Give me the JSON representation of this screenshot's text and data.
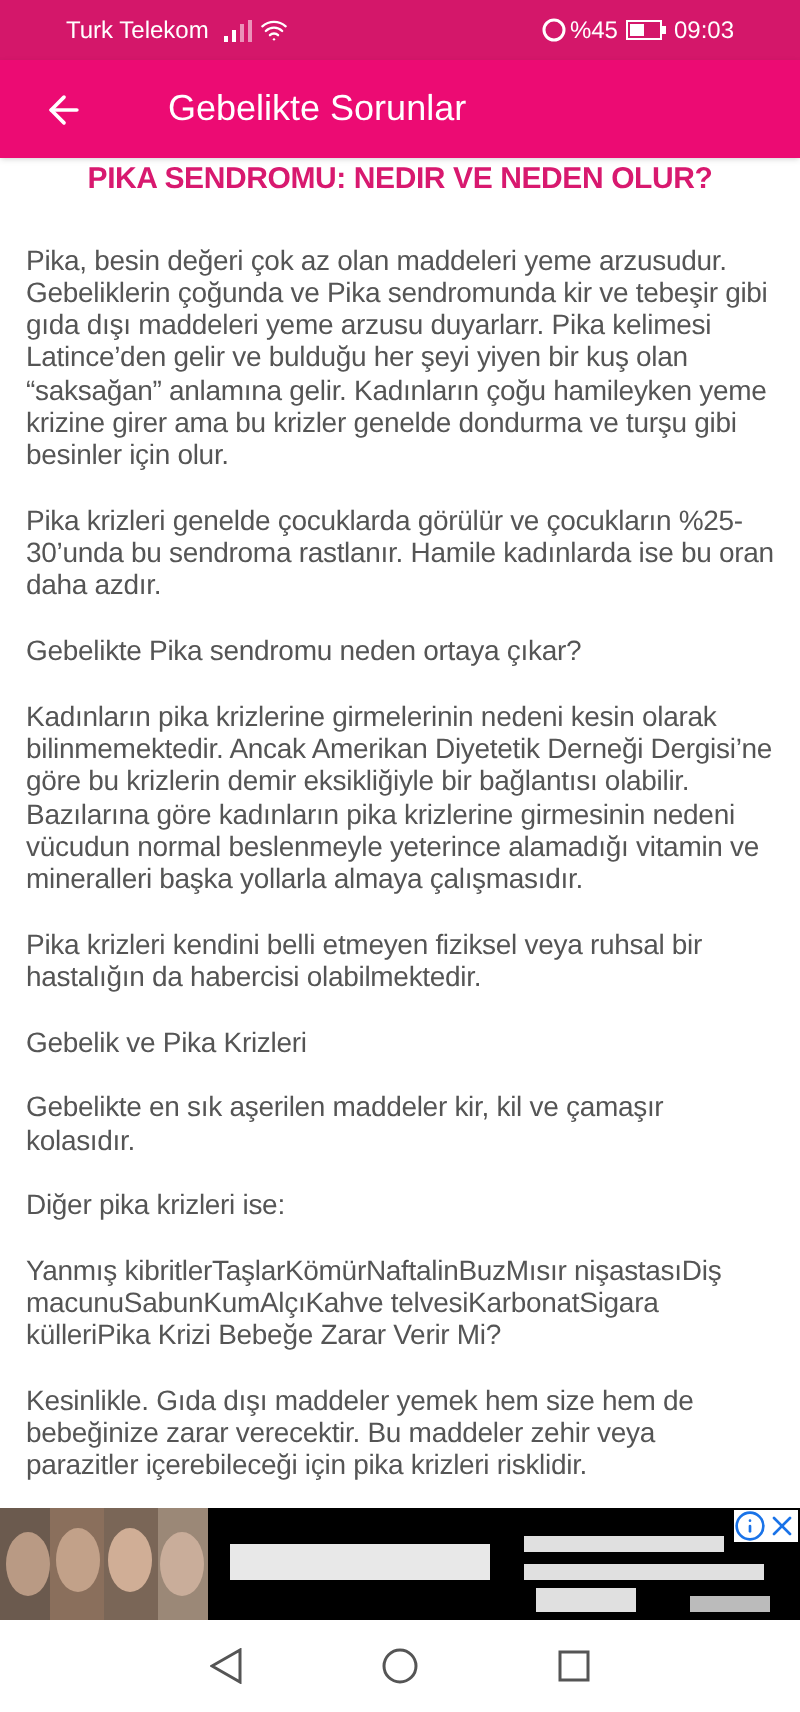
{
  "status_bar": {
    "carrier": "Turk Telekom",
    "battery": "%45",
    "time": "09:03"
  },
  "app_bar": {
    "title": "Gebelikte Sorunlar"
  },
  "article": {
    "heading": "PIKA SENDROMU: NEDIR VE NEDEN OLUR?",
    "paragraphs": [
      "Pika, besin değeri çok az olan maddeleri yeme arzusudur. Gebeliklerin çoğunda ve Pika sendromunda kir ve tebeşir gibi gıda dışı maddeleri yeme arzusu duyarlarr. Pika kelimesi Latince’den gelir ve bulduğu her şeyi yiyen bir kuş olan “saksağan” anlamına gelir. Kadınların çoğu hamileyken yeme krizine girer ama bu krizler genelde dondurma ve turşu gibi besinler için olur.",
      "Pika krizleri genelde çocuklarda görülür ve çocukların %25-30’unda bu sendroma rastlanır. Hamile kadınlarda ise bu oran daha azdır.",
      "Gebelikte Pika sendromu neden ortaya çıkar?",
      "Kadınların pika krizlerine girmelerinin nedeni kesin olarak bilinmemektedir. Ancak Amerikan Diyetetik Derneği Dergisi’ne göre bu krizlerin demir eksikliğiyle bir bağlantısı olabilir. Bazılarına göre kadınların pika krizlerine girmesinin nedeni vücudun normal beslenmeyle yeterince alamadığı vitamin ve mineralleri başka yollarla almaya çalışmasıdır.",
      "Pika krizleri kendini belli etmeyen fiziksel veya ruhsal bir hastalığın da habercisi olabilmektedir.",
      "Gebelik ve Pika Krizleri",
      "Gebelikte en sık aşerilen maddeler kir, kil ve çamaşır kolasıdır.",
      "Diğer pika krizleri ise:",
      "Yanmış kibritlerTaşlarKömürNaftalinBuzMısır nişastasıDiş macunuSabunKumAlçıKahve telvesiKarbonatSigara külleriPika Krizi Bebeğe Zarar Verir Mi?",
      "Kesinlikle. Gıda dışı maddeler yemek hem size hem de bebeğinize zarar verecektir. Bu maddeler zehir veya parazitler içerebileceği için pika krizleri risklidir."
    ]
  }
}
